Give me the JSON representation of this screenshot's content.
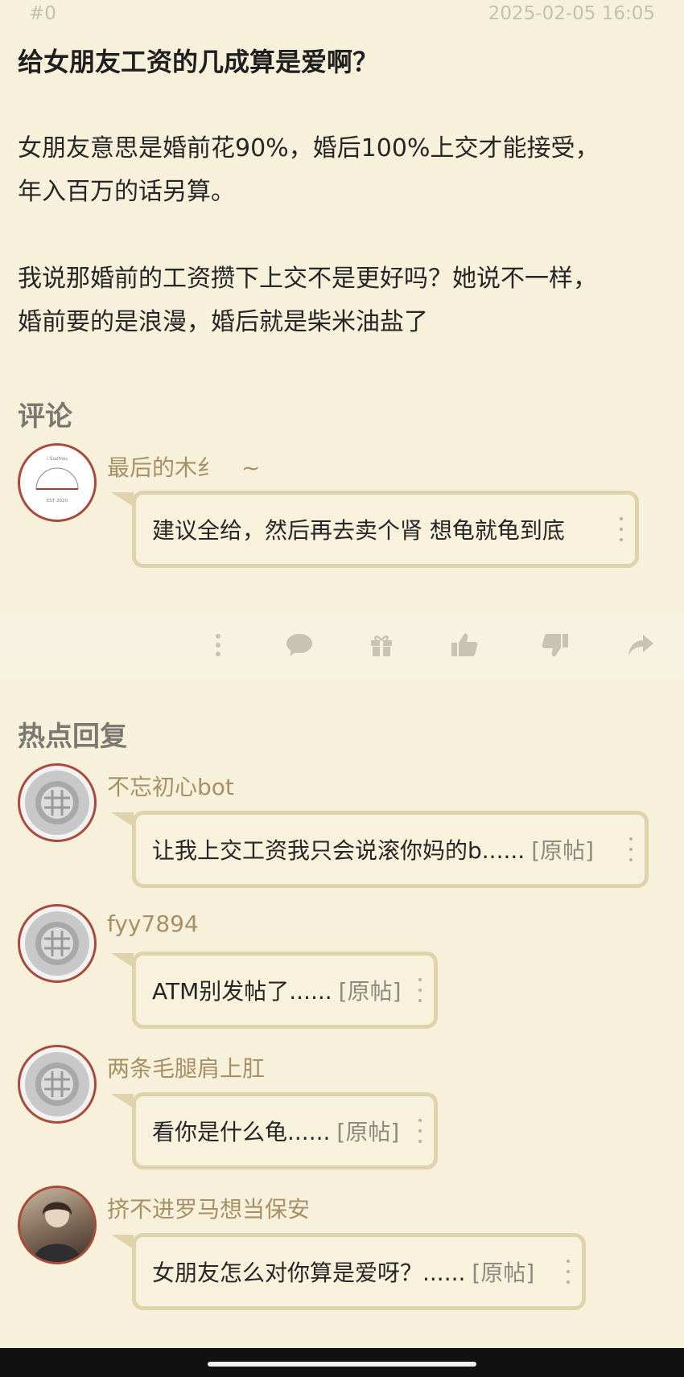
{
  "post": {
    "number": "#0",
    "timestamp": "2025-02-05 16:05",
    "title": "给女朋友工资的几成算是爱啊？",
    "paragraphs": [
      "女朋友意思是婚前花90%，婚后100%上交才能接受，",
      "年入百万的话另算。",
      "我说那婚前的工资攒下上交不是更好吗？她说不一样，",
      "婚前要的是浪漫，婚后就是柴米油盐了"
    ]
  },
  "comments_section": {
    "title": "评论",
    "comment": {
      "username": "最后的木纟",
      "username_suffix": "~",
      "text": "建议全给，然后再去卖个肾 想龟就龟到底",
      "avatar_text_top": "i Suzhou",
      "avatar_text_bottom": "EST 2020"
    }
  },
  "actions": {
    "icons": [
      "more-vertical-icon",
      "comment-icon",
      "gift-icon",
      "thumbs-up-icon",
      "thumbs-down-icon",
      "share-icon"
    ]
  },
  "hot_replies": {
    "title": "热点回复",
    "items": [
      {
        "username": "不忘初心bot",
        "text": "让我上交工资我只会说滚你妈的b......",
        "orig": "[原帖]"
      },
      {
        "username": "fyy7894",
        "text": "ATM别发帖了......",
        "orig": "[原帖]"
      },
      {
        "username": "两条毛腿肩上肛",
        "text": "看你是什么龟......",
        "orig": "[原帖]"
      },
      {
        "username": "挤不进罗马想当保安",
        "text": "女朋友怎么对你算是爱呀？......",
        "orig": "[原帖]"
      }
    ]
  },
  "colors": {
    "background": "#f7f1dc",
    "bubble_border": "#e0d2aa",
    "username": "#a89066",
    "avatar_ring": "#a84b3a"
  }
}
